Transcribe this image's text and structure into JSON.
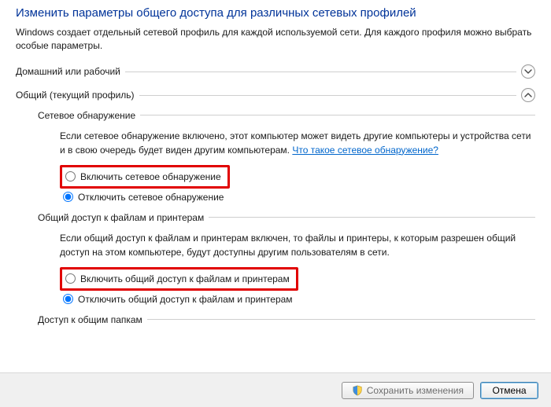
{
  "page_title": "Изменить параметры общего доступа для различных сетевых профилей",
  "intro": "Windows создает отдельный сетевой профиль для каждой используемой сети. Для каждого профиля можно выбрать особые параметры.",
  "sections": {
    "home": {
      "label": "Домашний или рабочий",
      "expanded": false
    },
    "public": {
      "label": "Общий (текущий профиль)",
      "expanded": true,
      "discovery": {
        "title": "Сетевое обнаружение",
        "desc_prefix": "Если сетевое обнаружение включено, этот компьютер может видеть другие компьютеры и устройства сети и в свою очередь будет виден другим компьютерам. ",
        "link": "Что такое сетевое обнаружение?",
        "opt_on": "Включить сетевое обнаружение",
        "opt_off": "Отключить сетевое обнаружение"
      },
      "fileshare": {
        "title": "Общий доступ к файлам и принтерам",
        "desc": "Если общий доступ к файлам и принтерам включен, то файлы и принтеры, к которым разрешен общий доступ на этом компьютере, будут доступны другим пользователям в сети.",
        "opt_on": "Включить общий доступ к файлам и принтерам",
        "opt_off": "Отключить общий доступ к файлам и принтерам"
      },
      "publicfolders": {
        "title": "Доступ к общим папкам"
      }
    }
  },
  "footer": {
    "save": "Сохранить изменения",
    "cancel": "Отмена"
  }
}
